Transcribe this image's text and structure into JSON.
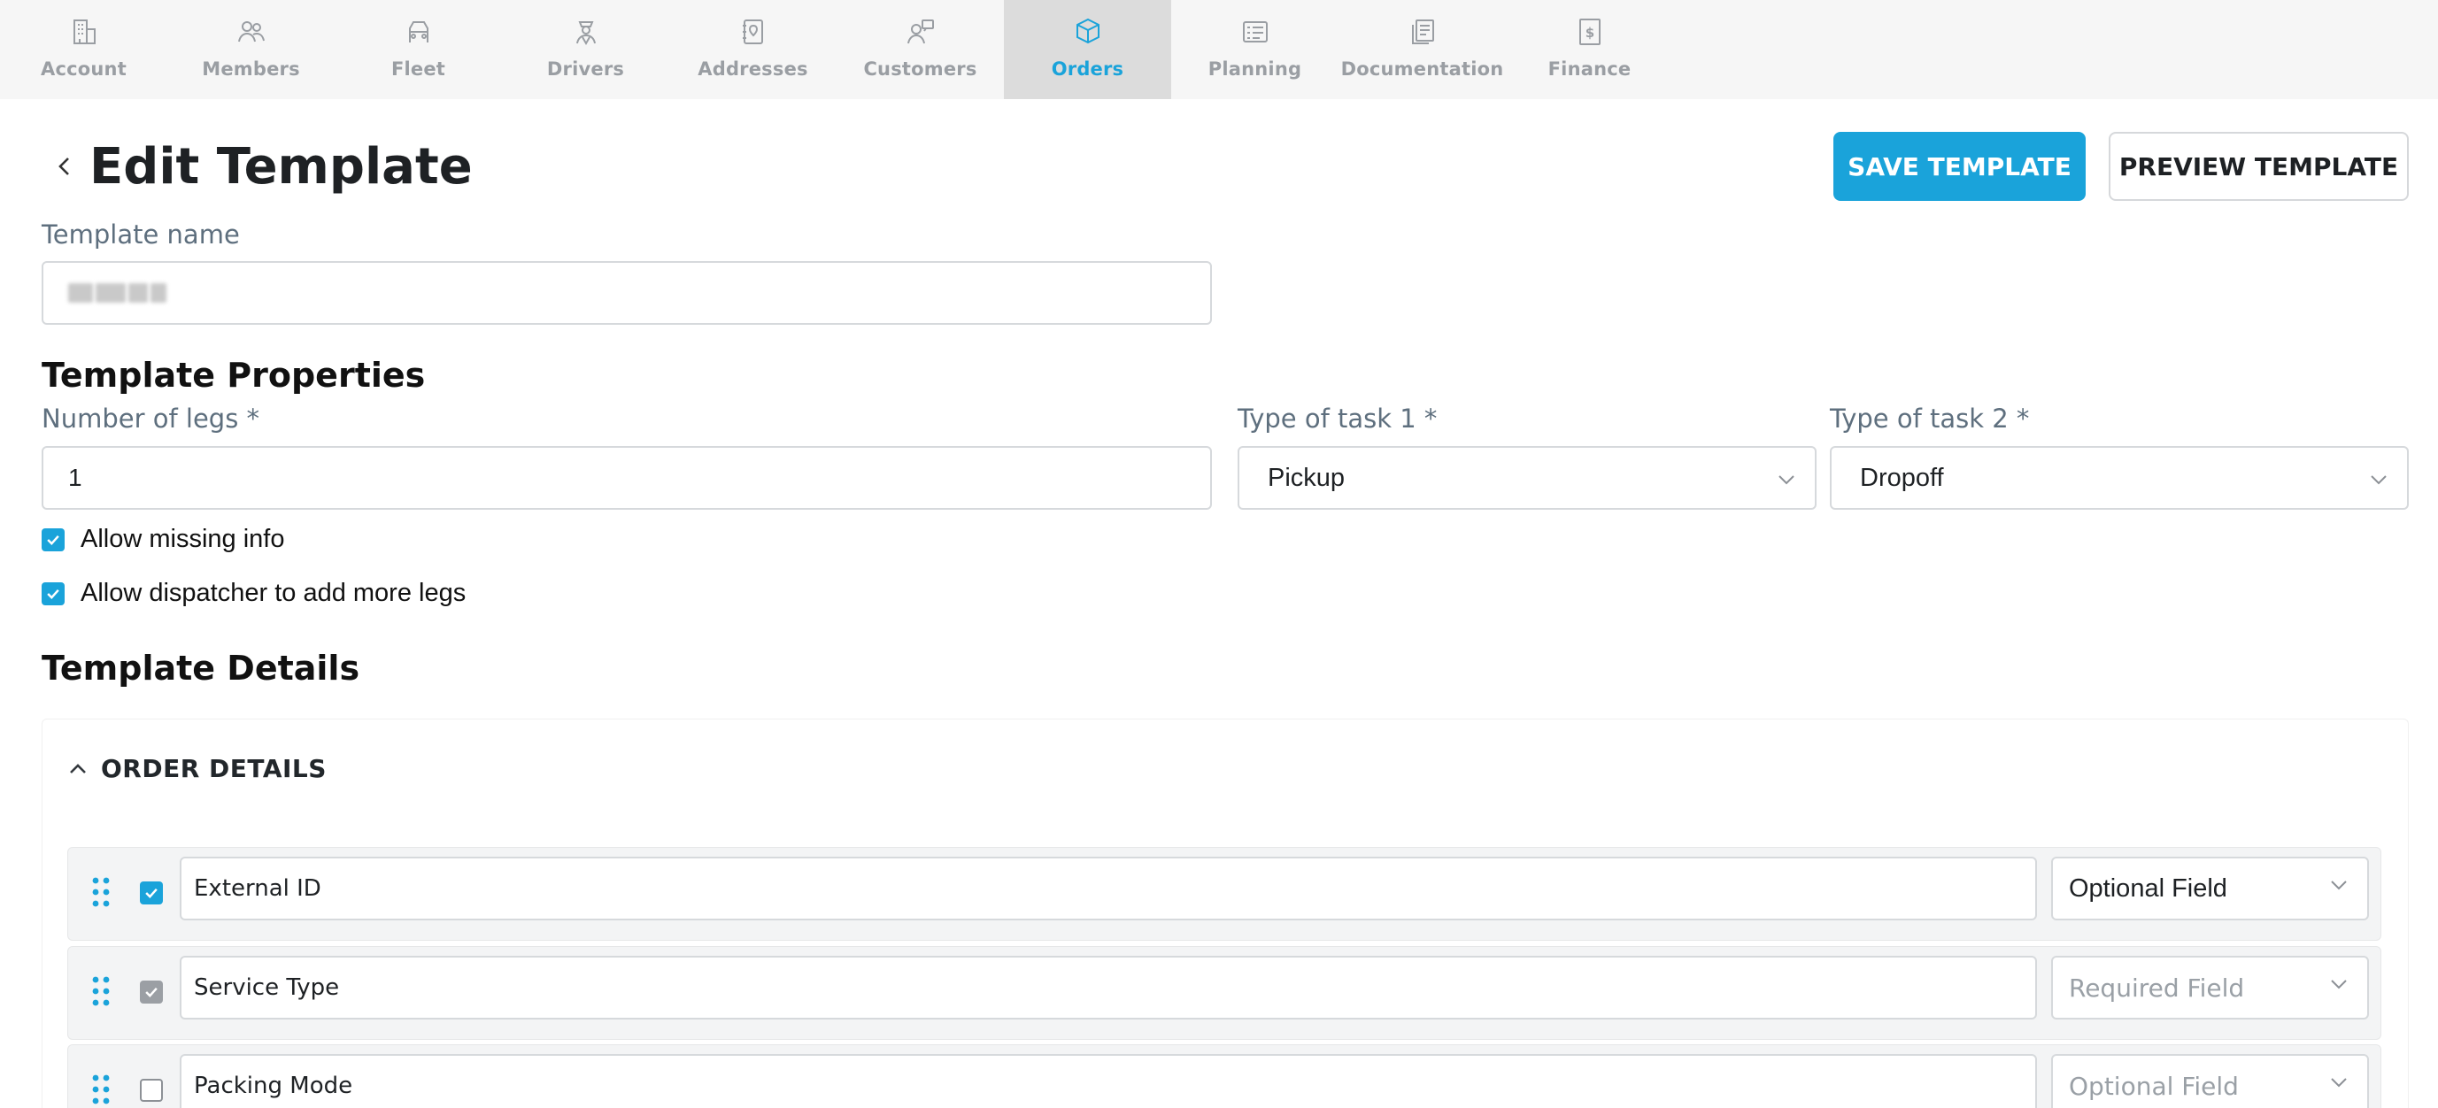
{
  "nav": {
    "items": [
      {
        "label": "Account",
        "icon": "building-icon",
        "active": false
      },
      {
        "label": "Members",
        "icon": "users-icon",
        "active": false
      },
      {
        "label": "Fleet",
        "icon": "truck-icon",
        "active": false
      },
      {
        "label": "Drivers",
        "icon": "driver-icon",
        "active": false
      },
      {
        "label": "Addresses",
        "icon": "address-book-icon",
        "active": false
      },
      {
        "label": "Customers",
        "icon": "customer-icon",
        "active": false
      },
      {
        "label": "Orders",
        "icon": "package-icon",
        "active": true
      },
      {
        "label": "Planning",
        "icon": "checklist-icon",
        "active": false
      },
      {
        "label": "Documentation",
        "icon": "documents-icon",
        "active": false
      },
      {
        "label": "Finance",
        "icon": "dollar-icon",
        "active": false
      }
    ],
    "active_color": "#1aa3da"
  },
  "header": {
    "title": "Edit Template",
    "save_label": "SAVE TEMPLATE",
    "preview_label": "PREVIEW TEMPLATE"
  },
  "template_name": {
    "label": "Template name",
    "value_redacted": true
  },
  "properties": {
    "title": "Template Properties",
    "legs_label": "Number of legs *",
    "legs_value": "1",
    "task1_label": "Type of task 1 *",
    "task1_value": "Pickup",
    "task2_label": "Type of task 2 *",
    "task2_value": "Dropoff",
    "allow_missing_label": "Allow missing info",
    "allow_missing_checked": true,
    "allow_more_legs_label": "Allow dispatcher to add more legs",
    "allow_more_legs_checked": true
  },
  "details": {
    "title": "Template Details",
    "section_title": "ORDER DETAILS",
    "rows": [
      {
        "name": "External ID",
        "checked": true,
        "locked": false,
        "requirement": "Optional Field"
      },
      {
        "name": "Service Type",
        "checked": true,
        "locked": true,
        "requirement": "Required Field"
      },
      {
        "name": "Packing Mode",
        "checked": false,
        "locked": false,
        "requirement": "Optional Field"
      }
    ]
  },
  "colors": {
    "accent": "#1aa3da",
    "label": "#5e6f7e",
    "nav_bg": "#f6f6f6"
  }
}
